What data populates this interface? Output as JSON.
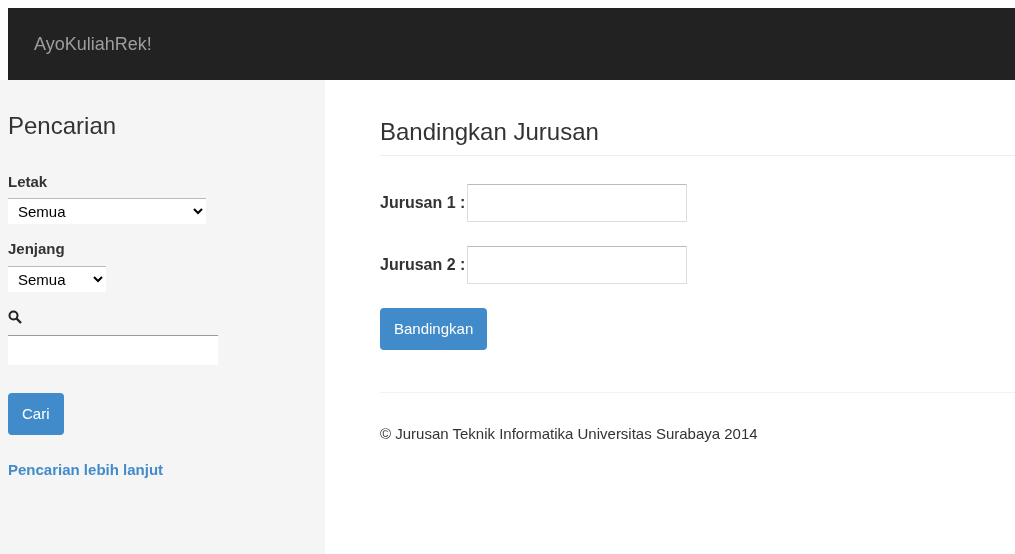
{
  "navbar": {
    "brand": "AyoKuliahRek!"
  },
  "sidebar": {
    "title": "Pencarian",
    "filters": [
      {
        "label": "Letak",
        "value": "Semua",
        "kind": "wide"
      },
      {
        "label": "Jenjang",
        "value": "Semua",
        "kind": "narrow"
      }
    ],
    "button": "Cari",
    "link": "Pencarian lebih lanjut"
  },
  "main": {
    "title": "Bandingkan Jurusan",
    "fields": [
      {
        "label": "Jurusan 1 :"
      },
      {
        "label": "Jurusan 2 :"
      }
    ],
    "button": "Bandingkan"
  },
  "footer": "© Jurusan Teknik Informatika Universitas Surabaya 2014"
}
